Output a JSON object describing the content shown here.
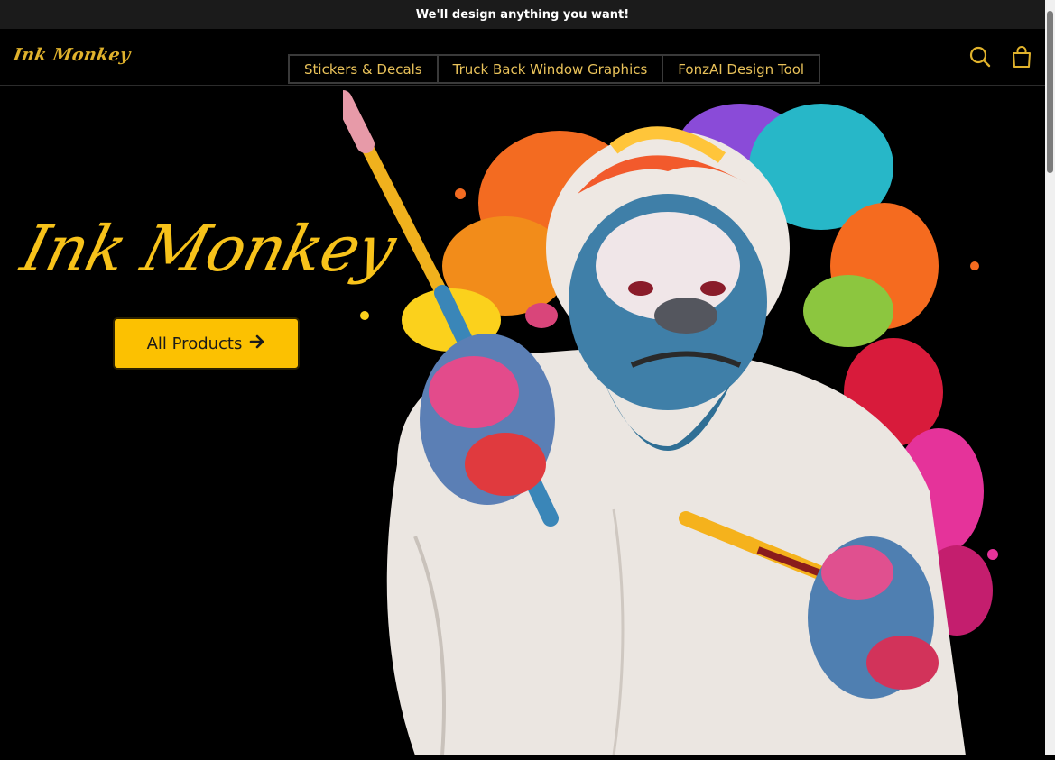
{
  "announcement": {
    "text": "We'll design anything you want!"
  },
  "header": {
    "logo_text": "Ink Monkey",
    "nav": [
      {
        "label": "Stickers & Decals"
      },
      {
        "label": "Truck Back Window Graphics"
      },
      {
        "label": "FonzAI Design Tool"
      }
    ],
    "icons": {
      "search": "search-icon",
      "cart": "shopping-bag-icon"
    }
  },
  "hero": {
    "title": "Ink Monkey",
    "cta_label": "All Products",
    "cta_icon": "arrow-right-icon"
  },
  "colors": {
    "accent": "#fcc101",
    "nav_text": "#e9c25a",
    "background": "#000000"
  }
}
